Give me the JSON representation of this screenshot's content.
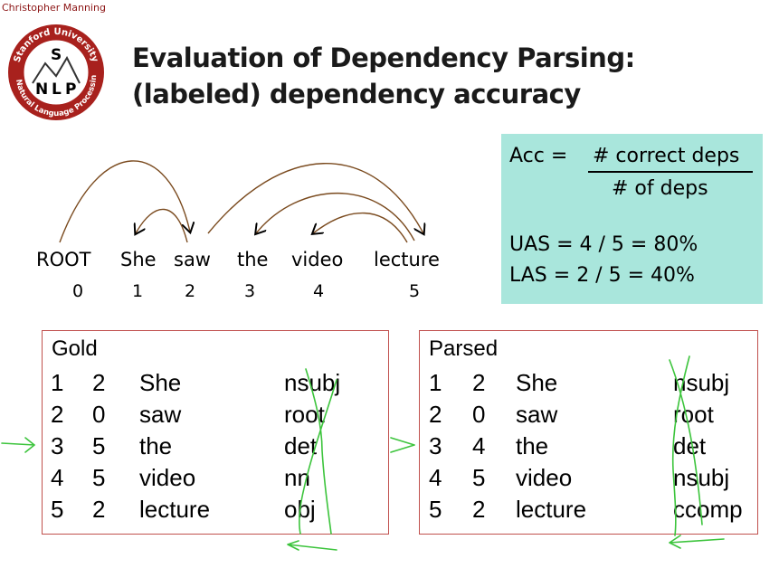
{
  "author": "Christopher Manning",
  "logo": {
    "top_text": "Stanford University",
    "bottom_text": "Natural Language Processing",
    "letters": [
      "S",
      "N",
      "L",
      "P"
    ]
  },
  "title": {
    "line1": "Evaluation of Dependency Parsing:",
    "line2": "(labeled) dependency accuracy"
  },
  "formula": {
    "lhs": "Acc  =",
    "numerator": "# correct deps",
    "denominator": "# of deps",
    "uas": "UAS =  4 / 5  =  80%",
    "las": "LAS  =  2 / 5  =  40%"
  },
  "sentence": {
    "words": [
      "ROOT",
      "She",
      "saw",
      "the",
      "video",
      "lecture"
    ],
    "indices": [
      "0",
      "1",
      "2",
      "3",
      "4",
      "5"
    ]
  },
  "gold": {
    "header": "Gold",
    "rows": [
      [
        "1",
        "2",
        "She",
        "nsubj"
      ],
      [
        "2",
        "0",
        "saw",
        "root"
      ],
      [
        "3",
        "5",
        "the",
        "det"
      ],
      [
        "4",
        "5",
        "video",
        "nn"
      ],
      [
        "5",
        "2",
        "lecture",
        "obj"
      ]
    ]
  },
  "parsed": {
    "header": "Parsed",
    "rows": [
      [
        "1",
        "2",
        "She",
        "nsubj"
      ],
      [
        "2",
        "0",
        "saw",
        "root"
      ],
      [
        "3",
        "4",
        "the",
        "det"
      ],
      [
        "4",
        "5",
        "video",
        "nsubj"
      ],
      [
        "5",
        "2",
        "lecture",
        "ccomp"
      ]
    ]
  },
  "colors": {
    "accent": "#8c1515",
    "formula_bg": "#a9e6dc",
    "table_border": "#c0504d",
    "annotation": "#3cc43c",
    "arc": "#7a4a1e"
  }
}
